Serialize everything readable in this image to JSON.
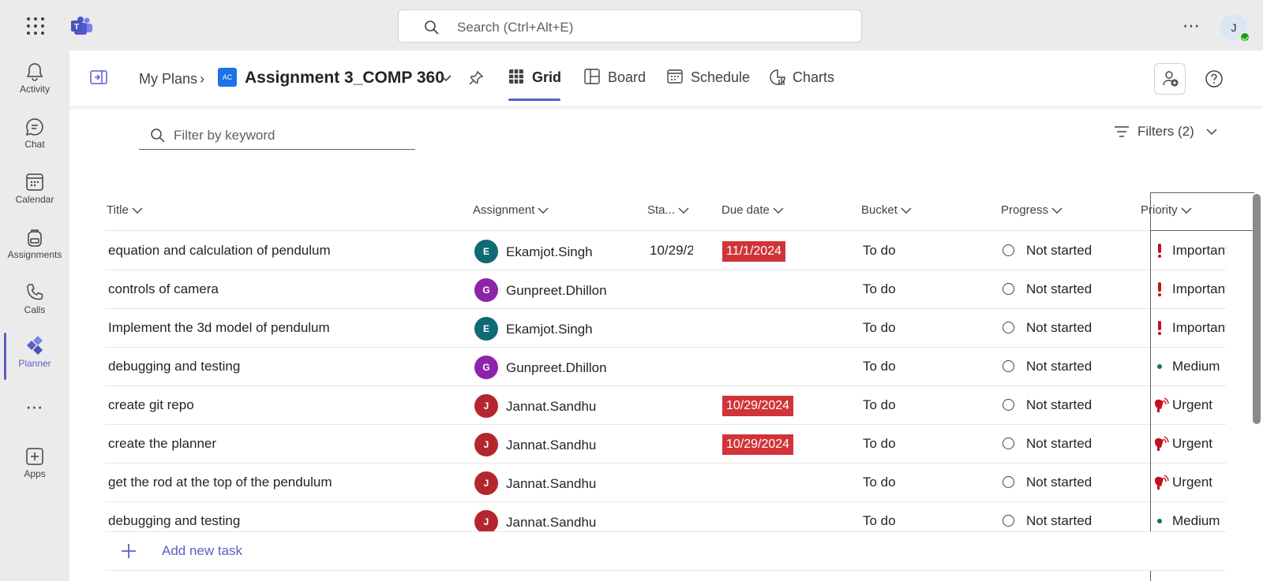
{
  "search": {
    "placeholder": "Search (Ctrl+Alt+E)"
  },
  "user": {
    "initial": "J"
  },
  "rail": [
    {
      "label": "Activity",
      "icon": "bell-icon"
    },
    {
      "label": "Chat",
      "icon": "chat-icon"
    },
    {
      "label": "Calendar",
      "icon": "calendar-icon"
    },
    {
      "label": "Assignments",
      "icon": "backpack-icon"
    },
    {
      "label": "Calls",
      "icon": "phone-icon"
    },
    {
      "label": "Planner",
      "icon": "planner-icon",
      "active": true
    },
    {
      "label": "Apps",
      "icon": "add-app-icon"
    }
  ],
  "header": {
    "crumb_root": "My Plans",
    "plan_badge": "AC",
    "plan_title": "Assignment 3_COMP 360",
    "tabs": [
      {
        "label": "Grid",
        "active": true
      },
      {
        "label": "Board"
      },
      {
        "label": "Schedule"
      },
      {
        "label": "Charts"
      }
    ]
  },
  "toolbar": {
    "filter_placeholder": "Filter by keyword",
    "filters_label": "Filters (2)"
  },
  "columns": {
    "title": "Title",
    "assignment": "Assignment",
    "start": "Sta...",
    "due": "Due date",
    "bucket": "Bucket",
    "progress": "Progress",
    "priority": "Priority"
  },
  "rows": [
    {
      "title": "equation and calculation of pendulum",
      "initial": "E",
      "assignee": "Ekamjot.Singh",
      "color": "#0e6a75",
      "start": "10/29/2",
      "due": "11/1/2024",
      "bucket": "To do",
      "progress": "Not started",
      "priority": "Important",
      "pico": "important"
    },
    {
      "title": "controls of camera",
      "initial": "G",
      "assignee": "Gunpreet.Dhillon",
      "color": "#8e24aa",
      "start": "",
      "due": "",
      "bucket": "To do",
      "progress": "Not started",
      "priority": "Important",
      "pico": "important"
    },
    {
      "title": "Implement the 3d model of pendulum",
      "initial": "E",
      "assignee": "Ekamjot.Singh",
      "color": "#0e6a75",
      "start": "",
      "due": "",
      "bucket": "To do",
      "progress": "Not started",
      "priority": "Important",
      "pico": "important"
    },
    {
      "title": "debugging and testing",
      "initial": "G",
      "assignee": "Gunpreet.Dhillon",
      "color": "#8e24aa",
      "start": "",
      "due": "",
      "bucket": "To do",
      "progress": "Not started",
      "priority": "Medium",
      "pico": "medium"
    },
    {
      "title": "create git repo",
      "initial": "J",
      "assignee": "Jannat.Sandhu",
      "color": "#b4262e",
      "start": "",
      "due": "10/29/2024",
      "bucket": "To do",
      "progress": "Not started",
      "priority": "Urgent",
      "pico": "urgent"
    },
    {
      "title": "create the planner",
      "initial": "J",
      "assignee": "Jannat.Sandhu",
      "color": "#b4262e",
      "start": "",
      "due": "10/29/2024",
      "bucket": "To do",
      "progress": "Not started",
      "priority": "Urgent",
      "pico": "urgent"
    },
    {
      "title": "get the rod at the top of the pendulum",
      "initial": "J",
      "assignee": "Jannat.Sandhu",
      "color": "#b4262e",
      "start": "",
      "due": "",
      "bucket": "To do",
      "progress": "Not started",
      "priority": "Urgent",
      "pico": "urgent"
    },
    {
      "title": "debugging and testing",
      "initial": "J",
      "assignee": "Jannat.Sandhu",
      "color": "#b4262e",
      "start": "",
      "due": "",
      "bucket": "To do",
      "progress": "Not started",
      "priority": "Medium",
      "pico": "medium"
    }
  ],
  "add_task_label": "Add new task",
  "colors": {
    "accent": "#5b5fc7",
    "overdue": "#d13438",
    "important": "#c50f1f",
    "medium": "#107c41"
  }
}
